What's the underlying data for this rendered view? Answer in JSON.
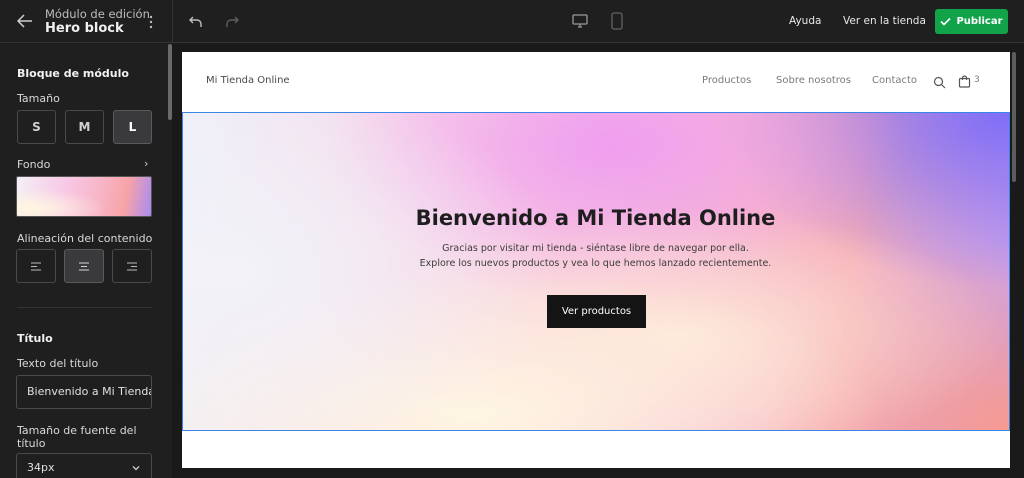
{
  "header": {
    "subtitle": "Módulo de edición",
    "title": "Hero block",
    "links": {
      "help": "Ayuda",
      "view_store": "Ver en la tienda"
    },
    "publish_label": "Publicar"
  },
  "sidebar": {
    "section_title": "Bloque de módulo",
    "size_label": "Tamaño",
    "sizes": [
      "S",
      "M",
      "L"
    ],
    "selected_size": "L",
    "background_label": "Fondo",
    "alignment_label": "Alineación del contenido",
    "selected_alignment": "center",
    "title_section": "Título",
    "title_text_label": "Texto del título",
    "title_text_value": "Bienvenido a Mi Tienda Online",
    "font_size_label": "Tamaño de fuente del título",
    "font_size_value": "34px"
  },
  "site": {
    "brand": "Mi Tienda Online",
    "nav": [
      "Productos",
      "Sobre nosotros",
      "Contacto"
    ],
    "cart_count": "3",
    "hero": {
      "heading": "Bienvenido a Mi Tienda Online",
      "line1": "Gracias por visitar mi tienda - siéntase libre de navegar por ella.",
      "line2": "Explore los nuevos productos y vea lo que hemos lanzado recientemente.",
      "cta": "Ver productos"
    }
  },
  "colors": {
    "publish": "#12a34a",
    "selection": "#3a86e8",
    "panel": "#1f1f1f"
  }
}
